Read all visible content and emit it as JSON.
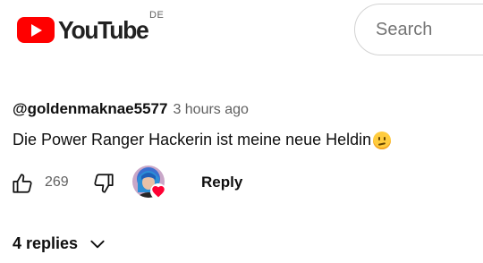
{
  "header": {
    "logo_text": "YouTube",
    "country_code": "DE",
    "search": {
      "placeholder": "Search"
    }
  },
  "comment": {
    "author": "@goldenmaknae5577",
    "time": "3 hours ago",
    "text": "Die Power Ranger Hackerin ist meine neue Heldin",
    "emoji": "saluting-face",
    "like_count": "269",
    "reply_label": "Reply",
    "creator_heart": true
  },
  "replies": {
    "label": "4 replies"
  },
  "colors": {
    "brand_red": "#ff0000",
    "text_primary": "#0f0f0f",
    "text_secondary": "#606060",
    "heart_red": "#ff0033"
  },
  "icons": {
    "like": "thumb-up-icon",
    "dislike": "thumb-down-icon",
    "heart": "heart-icon",
    "expand": "chevron-down-icon"
  }
}
